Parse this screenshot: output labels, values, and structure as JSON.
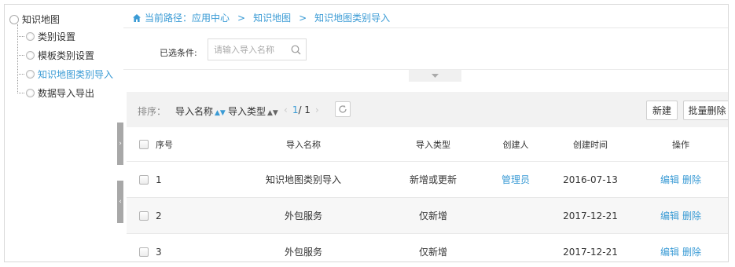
{
  "sidebar": {
    "root_label": "知识地图",
    "items": [
      {
        "label": "类别设置",
        "active": false
      },
      {
        "label": "模板类别设置",
        "active": false
      },
      {
        "label": "知识地图类别导入",
        "active": true
      },
      {
        "label": "数据导入导出",
        "active": false
      }
    ]
  },
  "breadcrumb": {
    "prefix": "当前路径：",
    "items": [
      "应用中心",
      "知识地图",
      "知识地图类别导入"
    ],
    "separator": ">"
  },
  "filter": {
    "label": "已选条件:",
    "search_placeholder": "请输入导入名称"
  },
  "toolbar": {
    "sort_label": "排序：",
    "sort_name": "导入名称",
    "sort_type": "导入类型",
    "page_current": "1",
    "page_total": "/ 1",
    "new_button": "新建",
    "batch_delete_button": "批量删除"
  },
  "table": {
    "columns": [
      "序号",
      "导入名称",
      "导入类型",
      "创建人",
      "创建时间",
      "操作"
    ],
    "rows": [
      {
        "index": "1",
        "name": "知识地图类别导入",
        "type": "新增或更新",
        "creator": "管理员",
        "time": "2016-07-13",
        "edit": "编辑",
        "delete": "删除"
      },
      {
        "index": "2",
        "name": "外包服务",
        "type": "仅新增",
        "creator": "",
        "time": "2017-12-21",
        "edit": "编辑",
        "delete": "删除"
      },
      {
        "index": "3",
        "name": "外包服务",
        "type": "仅新增",
        "creator": "",
        "time": "2017-12-21",
        "edit": "编辑",
        "delete": "删除"
      }
    ]
  },
  "colors": {
    "accent": "#3a9bd5",
    "toolbar_bg": "#f2f2f2",
    "handle": "#a8a8a8"
  }
}
